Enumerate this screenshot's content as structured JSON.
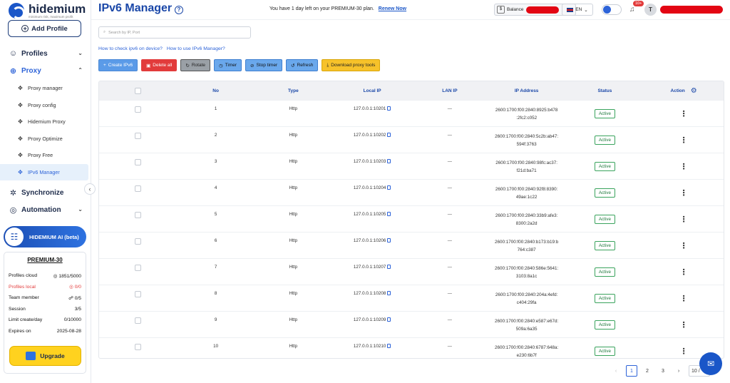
{
  "brand": {
    "name": "hidemium",
    "tagline": "minimum risk, maximum profit"
  },
  "sidebar": {
    "add_profile": "Add Profile",
    "nav": [
      {
        "label": "Profiles",
        "icon": "user-circle-icon"
      },
      {
        "label": "Proxy",
        "icon": "globe-icon"
      }
    ],
    "proxy_items": [
      {
        "label": "Proxy manager"
      },
      {
        "label": "Proxy config"
      },
      {
        "label": "Hidemium Proxy"
      },
      {
        "label": "Proxy Optimize"
      },
      {
        "label": "Proxy Free"
      },
      {
        "label": "IPv6 Manager"
      }
    ],
    "nav_bottom": [
      {
        "label": "Synchronize"
      },
      {
        "label": "Automation"
      }
    ],
    "ai_label": "HIDEMIUM AI (beta)",
    "plan": {
      "title": "PREMIUM-30",
      "rows": [
        {
          "label": "Profiles cloud",
          "value": "1851/5000"
        },
        {
          "label": "Profiles local",
          "value": "0/0"
        },
        {
          "label": "Team member",
          "value": "0/5"
        },
        {
          "label": "Session",
          "value": "3/5"
        },
        {
          "label": "Limit create/day",
          "value": "0/10000"
        },
        {
          "label": "Expires on",
          "value": "2025-08-28"
        }
      ],
      "upgrade": "Upgrade"
    }
  },
  "header": {
    "title": "IPv6 Manager",
    "notice": "You have 1 day left on your PREMIUM-30 plan.",
    "renew": "Renew Now",
    "balance_label": "Balance",
    "lang": "EN",
    "notif_count": "10+",
    "avatar_letter": "T"
  },
  "toolbar": {
    "search_placeholder": "Search by IP, Port",
    "link_check": "How to check ipv6 on device?",
    "link_use": "How to use IPv6 Manager?",
    "buttons": [
      "Create IPv6",
      "Delete all",
      "Rotate",
      "Timer",
      "Stop timer",
      "Refresh",
      "Download proxy tools"
    ]
  },
  "table": {
    "headers": [
      "No",
      "Type",
      "Local IP",
      "LAN IP",
      "IP Address",
      "Status",
      "Action"
    ],
    "rows": [
      {
        "no": "1",
        "type": "Http",
        "local": "127.0.0.1:10201",
        "lan": "---",
        "ip1": "2600:1700:f00:2840:8925:b478",
        "ip2": ":2fc2:c052",
        "status": "Active"
      },
      {
        "no": "2",
        "type": "Http",
        "local": "127.0.0.1:10202",
        "lan": "---",
        "ip1": "2600:1700:f00:2840:5c2b:ab47:",
        "ip2": "594f:3763",
        "status": "Active"
      },
      {
        "no": "3",
        "type": "Http",
        "local": "127.0.0.1:10203",
        "lan": "---",
        "ip1": "2600:1700:f00:2840:98fc:ac37:",
        "ip2": "f21d:ba71",
        "status": "Active"
      },
      {
        "no": "4",
        "type": "Http",
        "local": "127.0.0.1:10204",
        "lan": "---",
        "ip1": "2600:1700:f00:2840:92f8:8390:",
        "ip2": "49ae:1c22",
        "status": "Active"
      },
      {
        "no": "5",
        "type": "Http",
        "local": "127.0.0.1:10205",
        "lan": "---",
        "ip1": "2600:1700:f00:2840:33b9:afe3:",
        "ip2": "8300:2a2d",
        "status": "Active"
      },
      {
        "no": "6",
        "type": "Http",
        "local": "127.0.0.1:10206",
        "lan": "---",
        "ip1": "2600:1700:f00:2840:b173:b19:b",
        "ip2": "764:c387",
        "status": "Active"
      },
      {
        "no": "7",
        "type": "Http",
        "local": "127.0.0.1:10207",
        "lan": "---",
        "ip1": "2600:1700:f00:2840:586e:5641:",
        "ip2": "3103:8a1c",
        "status": "Active"
      },
      {
        "no": "8",
        "type": "Http",
        "local": "127.0.0.1:10208",
        "lan": "---",
        "ip1": "2600:1700:f00:2840:204a:4efd:",
        "ip2": "c404:29fa",
        "status": "Active"
      },
      {
        "no": "9",
        "type": "Http",
        "local": "127.0.0.1:10209",
        "lan": "---",
        "ip1": "2600:1700:f00:2840:e587:e67d:",
        "ip2": "509a:6a35",
        "status": "Active"
      },
      {
        "no": "10",
        "type": "Http",
        "local": "127.0.0.1:10210",
        "lan": "---",
        "ip1": "2600:1700:f00:2840:6787:648a:",
        "ip2": "e230:6b7f",
        "status": "Active"
      }
    ]
  },
  "pagination": {
    "pages": [
      "1",
      "2",
      "3"
    ],
    "page_size": "10 /"
  }
}
